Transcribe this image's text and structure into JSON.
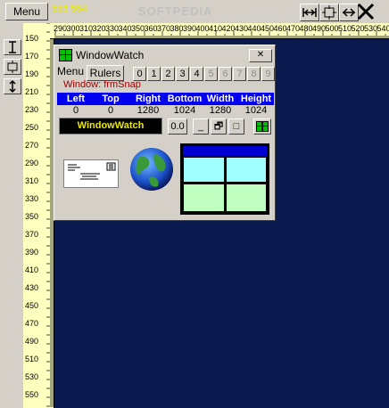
{
  "toolbar": {
    "menu_label": "Menu",
    "coords": "556 554",
    "watermark": "SOFTPEDIA"
  },
  "ruler_top": {
    "ticks": [
      "290",
      "300",
      "310",
      "320",
      "330",
      "340",
      "350",
      "360",
      "370",
      "380",
      "390",
      "400",
      "410",
      "420",
      "430",
      "440",
      "450",
      "460",
      "470",
      "480",
      "490",
      "500",
      "510",
      "520",
      "530",
      "540"
    ]
  },
  "ruler_left": {
    "ticks": [
      "150",
      "170",
      "190",
      "210",
      "230",
      "250",
      "270",
      "290",
      "310",
      "330",
      "350",
      "370",
      "390",
      "410",
      "430",
      "450",
      "470",
      "490",
      "510",
      "530",
      "550"
    ]
  },
  "window": {
    "title": "WindowWatch",
    "close_label": "✕",
    "menu_label": "Menu",
    "rulers_label": "Rulers",
    "numbers": [
      "0",
      "1",
      "2",
      "3",
      "4",
      "5",
      "6",
      "7",
      "8",
      "9"
    ],
    "window_text": "Window: frmSnap",
    "headers": [
      "Left",
      "Top",
      "Right",
      "Bottom",
      "Width",
      "Height"
    ],
    "values": [
      "0",
      "0",
      "1280",
      "1024",
      "1280",
      "1024"
    ],
    "name_label": "WindowWatch",
    "zoom_label": "0.0",
    "min_label": "_",
    "restore_label": "🗗",
    "max_label": "□"
  },
  "colors": {
    "background": "#0a1a4e",
    "ruler": "#ffffc0",
    "header": "#0000f0",
    "label_text": "#e8e800"
  }
}
